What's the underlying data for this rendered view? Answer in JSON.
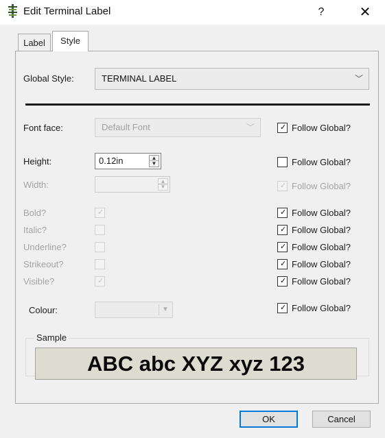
{
  "window": {
    "title": "Edit Terminal Label",
    "help_glyph": "?",
    "close_glyph": "✕"
  },
  "tabs": [
    {
      "label": "Label",
      "selected": false
    },
    {
      "label": "Style",
      "selected": true
    }
  ],
  "global_style": {
    "label": "Global Style:",
    "value": "TERMINAL LABEL"
  },
  "font_face": {
    "label": "Font face:",
    "value": "Default Font",
    "follow_global": {
      "label": "Follow Global?",
      "checked": true
    }
  },
  "height": {
    "label": "Height:",
    "value": "0.12in",
    "follow_global": {
      "label": "Follow Global?",
      "checked": false
    }
  },
  "width": {
    "label": "Width:",
    "value": "",
    "follow_global": {
      "label": "Follow Global?",
      "checked": true
    }
  },
  "bold": {
    "label": "Bold?",
    "checked": true,
    "follow_global": {
      "label": "Follow Global?",
      "checked": true
    }
  },
  "italic": {
    "label": "Italic?",
    "checked": false,
    "follow_global": {
      "label": "Follow Global?",
      "checked": true
    }
  },
  "underline": {
    "label": "Underline?",
    "checked": false,
    "follow_global": {
      "label": "Follow Global?",
      "checked": true
    }
  },
  "strikeout": {
    "label": "Strikeout?",
    "checked": false,
    "follow_global": {
      "label": "Follow Global?",
      "checked": true
    }
  },
  "visible": {
    "label": "Visible?",
    "checked": true,
    "follow_global": {
      "label": "Follow Global?",
      "checked": true
    }
  },
  "colour": {
    "label": "Colour:",
    "follow_global": {
      "label": "Follow Global?",
      "checked": true
    }
  },
  "sample": {
    "group_title": "Sample",
    "text": "ABC abc XYZ xyz 123",
    "background": "#dcdcd0"
  },
  "buttons": {
    "ok": "OK",
    "cancel": "Cancel"
  },
  "icons": {
    "app": "terminal-label-icon",
    "dropdown": "chevron-down-icon",
    "check": "✓"
  }
}
